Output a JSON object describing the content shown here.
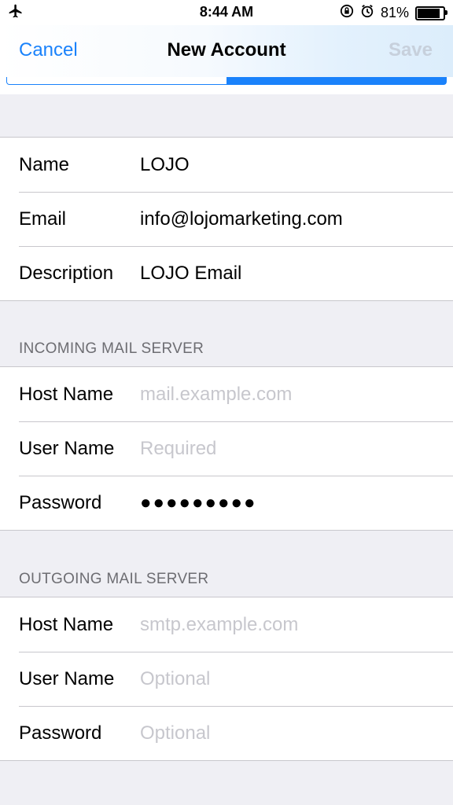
{
  "status_bar": {
    "time": "8:44 AM",
    "battery": "81%",
    "battery_level": 0.81,
    "icons": [
      "airplane-icon",
      "rotation-lock-icon",
      "alarm-icon",
      "battery-icon"
    ]
  },
  "nav": {
    "cancel": "Cancel",
    "title": "New Account",
    "save": "Save"
  },
  "accent_color": "#1a82fb",
  "progress": {
    "fraction": 0.5
  },
  "account": {
    "name_label": "Name",
    "name_value": "LOJO",
    "email_label": "Email",
    "email_value": "info@lojomarketing.com",
    "description_label": "Description",
    "description_value": "LOJO Email"
  },
  "incoming": {
    "header": "INCOMING MAIL SERVER",
    "host_label": "Host Name",
    "host_placeholder": "mail.example.com",
    "user_label": "User Name",
    "user_placeholder": "Required",
    "password_label": "Password",
    "password_value": "●●●●●●●●●"
  },
  "outgoing": {
    "header": "OUTGOING MAIL SERVER",
    "host_label": "Host Name",
    "host_placeholder": "smtp.example.com",
    "user_label": "User Name",
    "user_placeholder": "Optional",
    "password_label": "Password",
    "password_placeholder": "Optional"
  }
}
